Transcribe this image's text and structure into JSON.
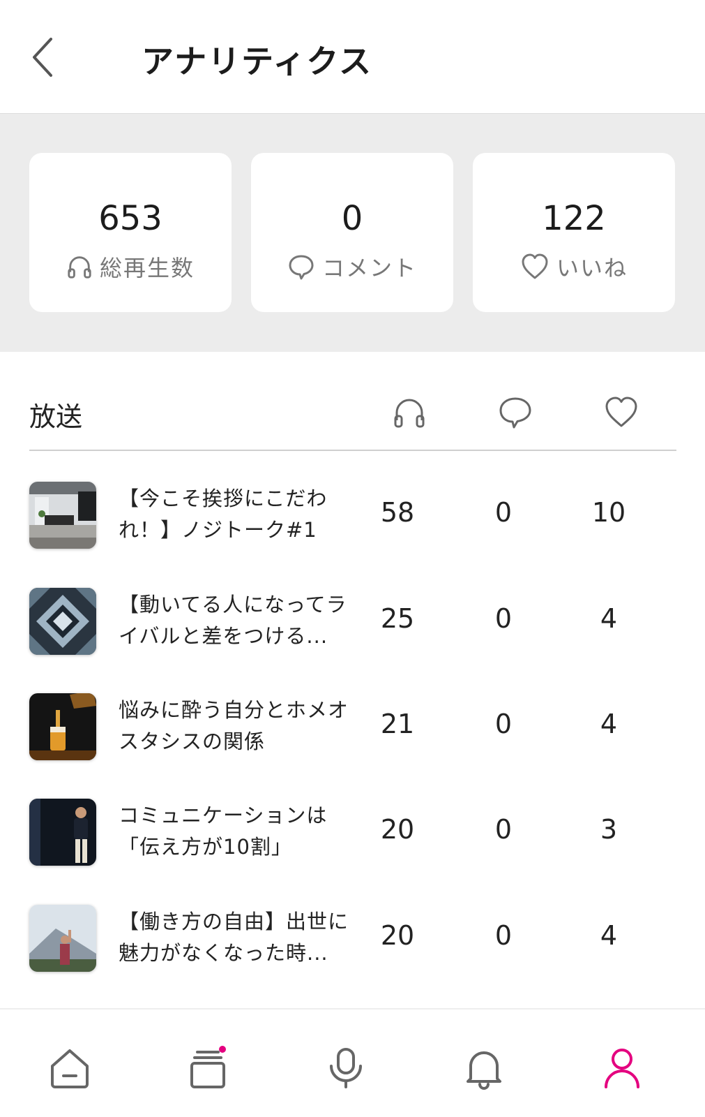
{
  "header": {
    "title": "アナリティクス",
    "back_icon": "chevron-left-icon"
  },
  "summary": [
    {
      "value": "653",
      "label": "総再生数",
      "icon": "headphones-icon"
    },
    {
      "value": "0",
      "label": "コメント",
      "icon": "comment-icon"
    },
    {
      "value": "122",
      "label": "いいね",
      "icon": "heart-icon"
    }
  ],
  "list": {
    "title": "放送",
    "column_icons": [
      "headphones-icon",
      "comment-icon",
      "heart-icon"
    ],
    "rows": [
      {
        "title": "【今こそ挨拶にこだわれ！】ノジトーク#1",
        "plays": "58",
        "comments": "0",
        "likes": "10",
        "thumb": "office-room"
      },
      {
        "title": "【動いてる人になってライバルと差をつける...",
        "plays": "25",
        "comments": "0",
        "likes": "4",
        "thumb": "kaleidoscope"
      },
      {
        "title": "悩みに酔う自分とホメオスタシスの関係",
        "plays": "21",
        "comments": "0",
        "likes": "4",
        "thumb": "beer-pour"
      },
      {
        "title": "コミュニケーションは「伝え方が10割」",
        "plays": "20",
        "comments": "0",
        "likes": "3",
        "thumb": "speaker-on-stage"
      },
      {
        "title": "【働き方の自由】出世に魅力がなくなった時...",
        "plays": "20",
        "comments": "0",
        "likes": "4",
        "thumb": "mountain-person"
      }
    ]
  },
  "tabbar": {
    "items": [
      "home-icon",
      "library-icon",
      "microphone-icon",
      "bell-icon",
      "profile-icon"
    ],
    "active": "profile-icon",
    "accent_color": "#e4007f",
    "inactive_color": "#666666"
  }
}
